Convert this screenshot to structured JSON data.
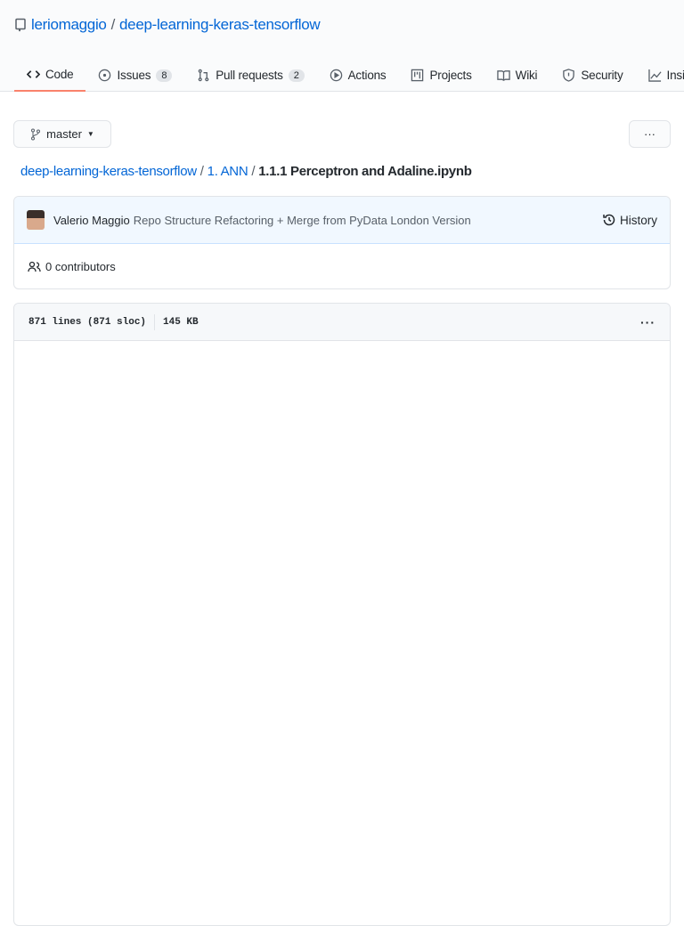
{
  "repo": {
    "owner": "leriomaggio",
    "separator": "/",
    "name": "deep-learning-keras-tensorflow"
  },
  "tabs": [
    {
      "label": "Code",
      "icon": "code-icon"
    },
    {
      "label": "Issues",
      "count": "8",
      "icon": "issue-icon"
    },
    {
      "label": "Pull requests",
      "count": "2",
      "icon": "pull-request-icon"
    },
    {
      "label": "Actions",
      "icon": "play-icon"
    },
    {
      "label": "Projects",
      "icon": "project-icon"
    },
    {
      "label": "Wiki",
      "icon": "book-icon"
    },
    {
      "label": "Security",
      "icon": "shield-icon"
    },
    {
      "label": "Insights",
      "icon": "graph-icon"
    }
  ],
  "branch": {
    "label": "master"
  },
  "more_label": "···",
  "breadcrumb": {
    "root": "deep-learning-keras-tensorflow",
    "folder": "1. ANN",
    "file": "1.1.1 Perceptron and Adaline.ipynb",
    "sep": "/"
  },
  "commit": {
    "author": "Valerio Maggio",
    "message": "Repo Structure Refactoring + Merge from PyData London Version",
    "history": "History"
  },
  "contributors": "0 contributors",
  "file": {
    "lines": "871 lines (871 sloc)",
    "size": "145 KB"
  }
}
